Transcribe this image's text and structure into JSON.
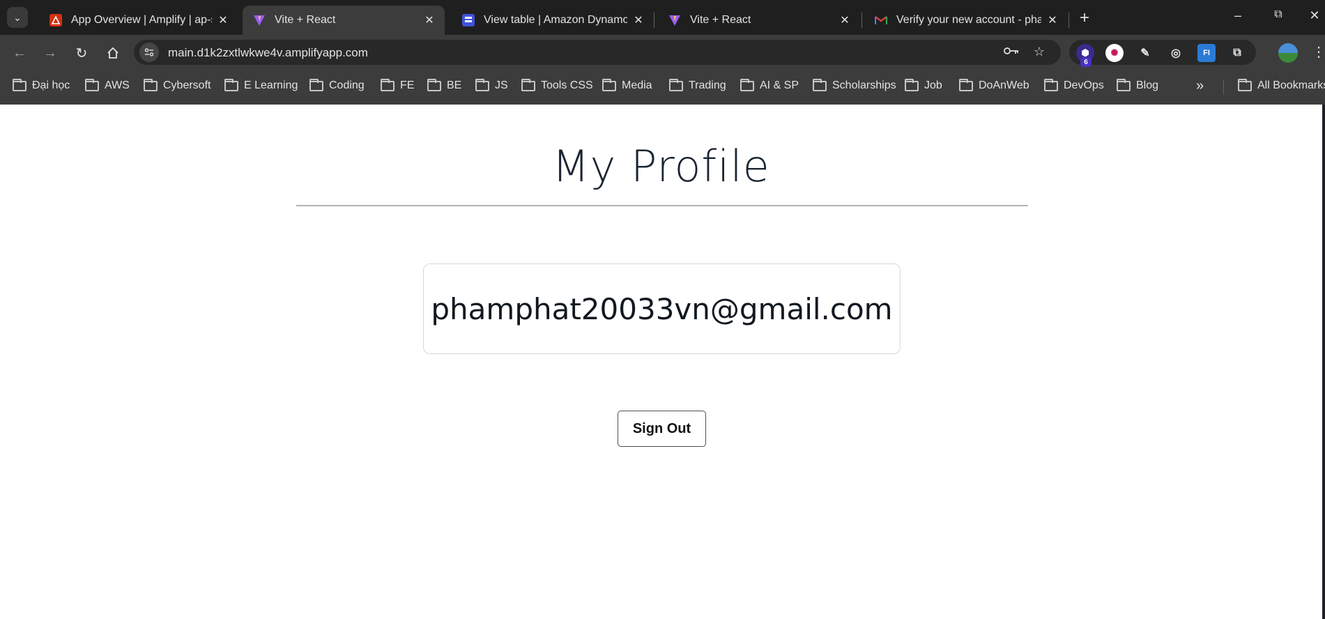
{
  "browser": {
    "tabs": [
      {
        "title": "App Overview | Amplify | ap-sou",
        "favicon": "amplify-icon",
        "active": false
      },
      {
        "title": "Vite + React",
        "favicon": "vite-icon",
        "active": true
      },
      {
        "title": "View table | Amazon DynamoDB",
        "favicon": "dynamodb-icon",
        "active": false
      },
      {
        "title": "Vite + React",
        "favicon": "vite-icon",
        "active": false
      },
      {
        "title": "Verify your new account - pham",
        "favicon": "gmail-icon",
        "active": false
      }
    ],
    "new_tab": "+",
    "url": "main.d1k2zxtlwkwe4v.amplifyapp.com",
    "extension_badge": "6",
    "bookmarks": [
      "Đại học",
      "AWS",
      "Cybersoft",
      "E Learning",
      "Coding",
      "FE",
      "BE",
      "JS",
      "Tools CSS",
      "Media",
      "Trading",
      "AI & SP",
      "Scholarships",
      "Job",
      "DoAnWeb",
      "DevOps",
      "Blog"
    ],
    "all_bookmarks": "All Bookmarks"
  },
  "page": {
    "title": "My Profile",
    "email": "phamphat20033vn@gmail.com",
    "sign_out_label": "Sign Out"
  },
  "colors": {
    "highlight": "#e02424",
    "heading": "#1b2432"
  }
}
